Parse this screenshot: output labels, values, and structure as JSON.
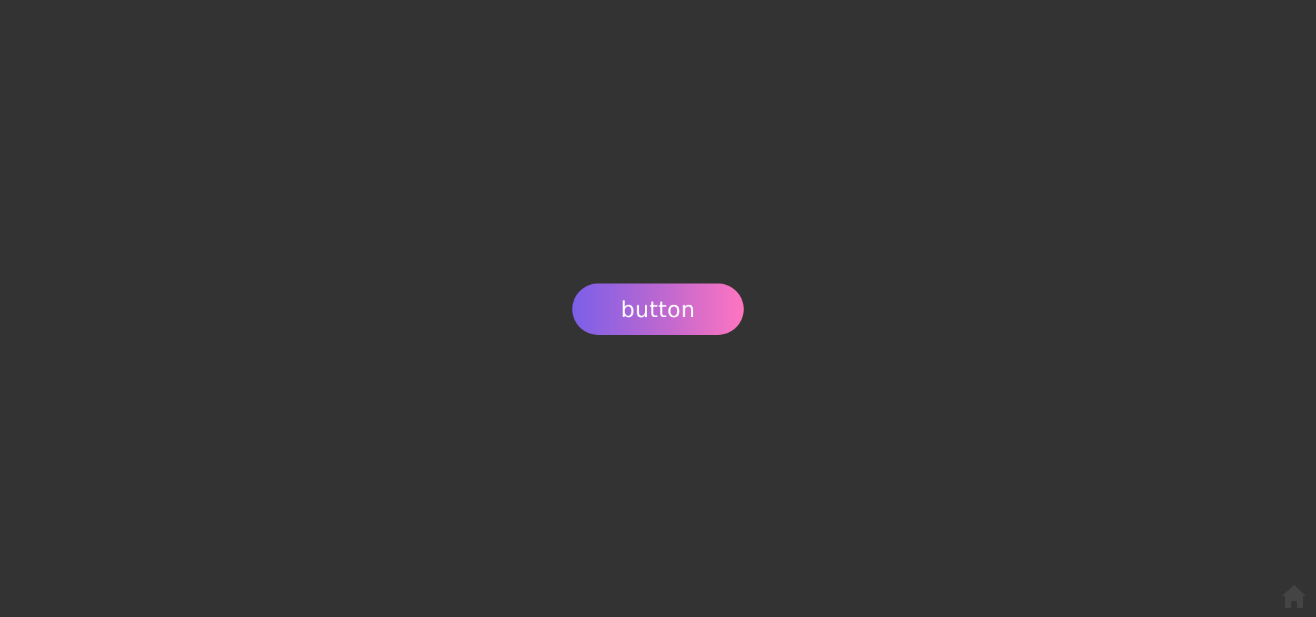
{
  "page": {
    "background": "#333333"
  },
  "main": {
    "button_label": "button",
    "button_gradient_start": "#7b5fe8",
    "button_gradient_end": "#ff75c0",
    "button_text_color": "#ffffff"
  },
  "corner": {
    "icon": "home-icon",
    "icon_color": "#444444"
  }
}
